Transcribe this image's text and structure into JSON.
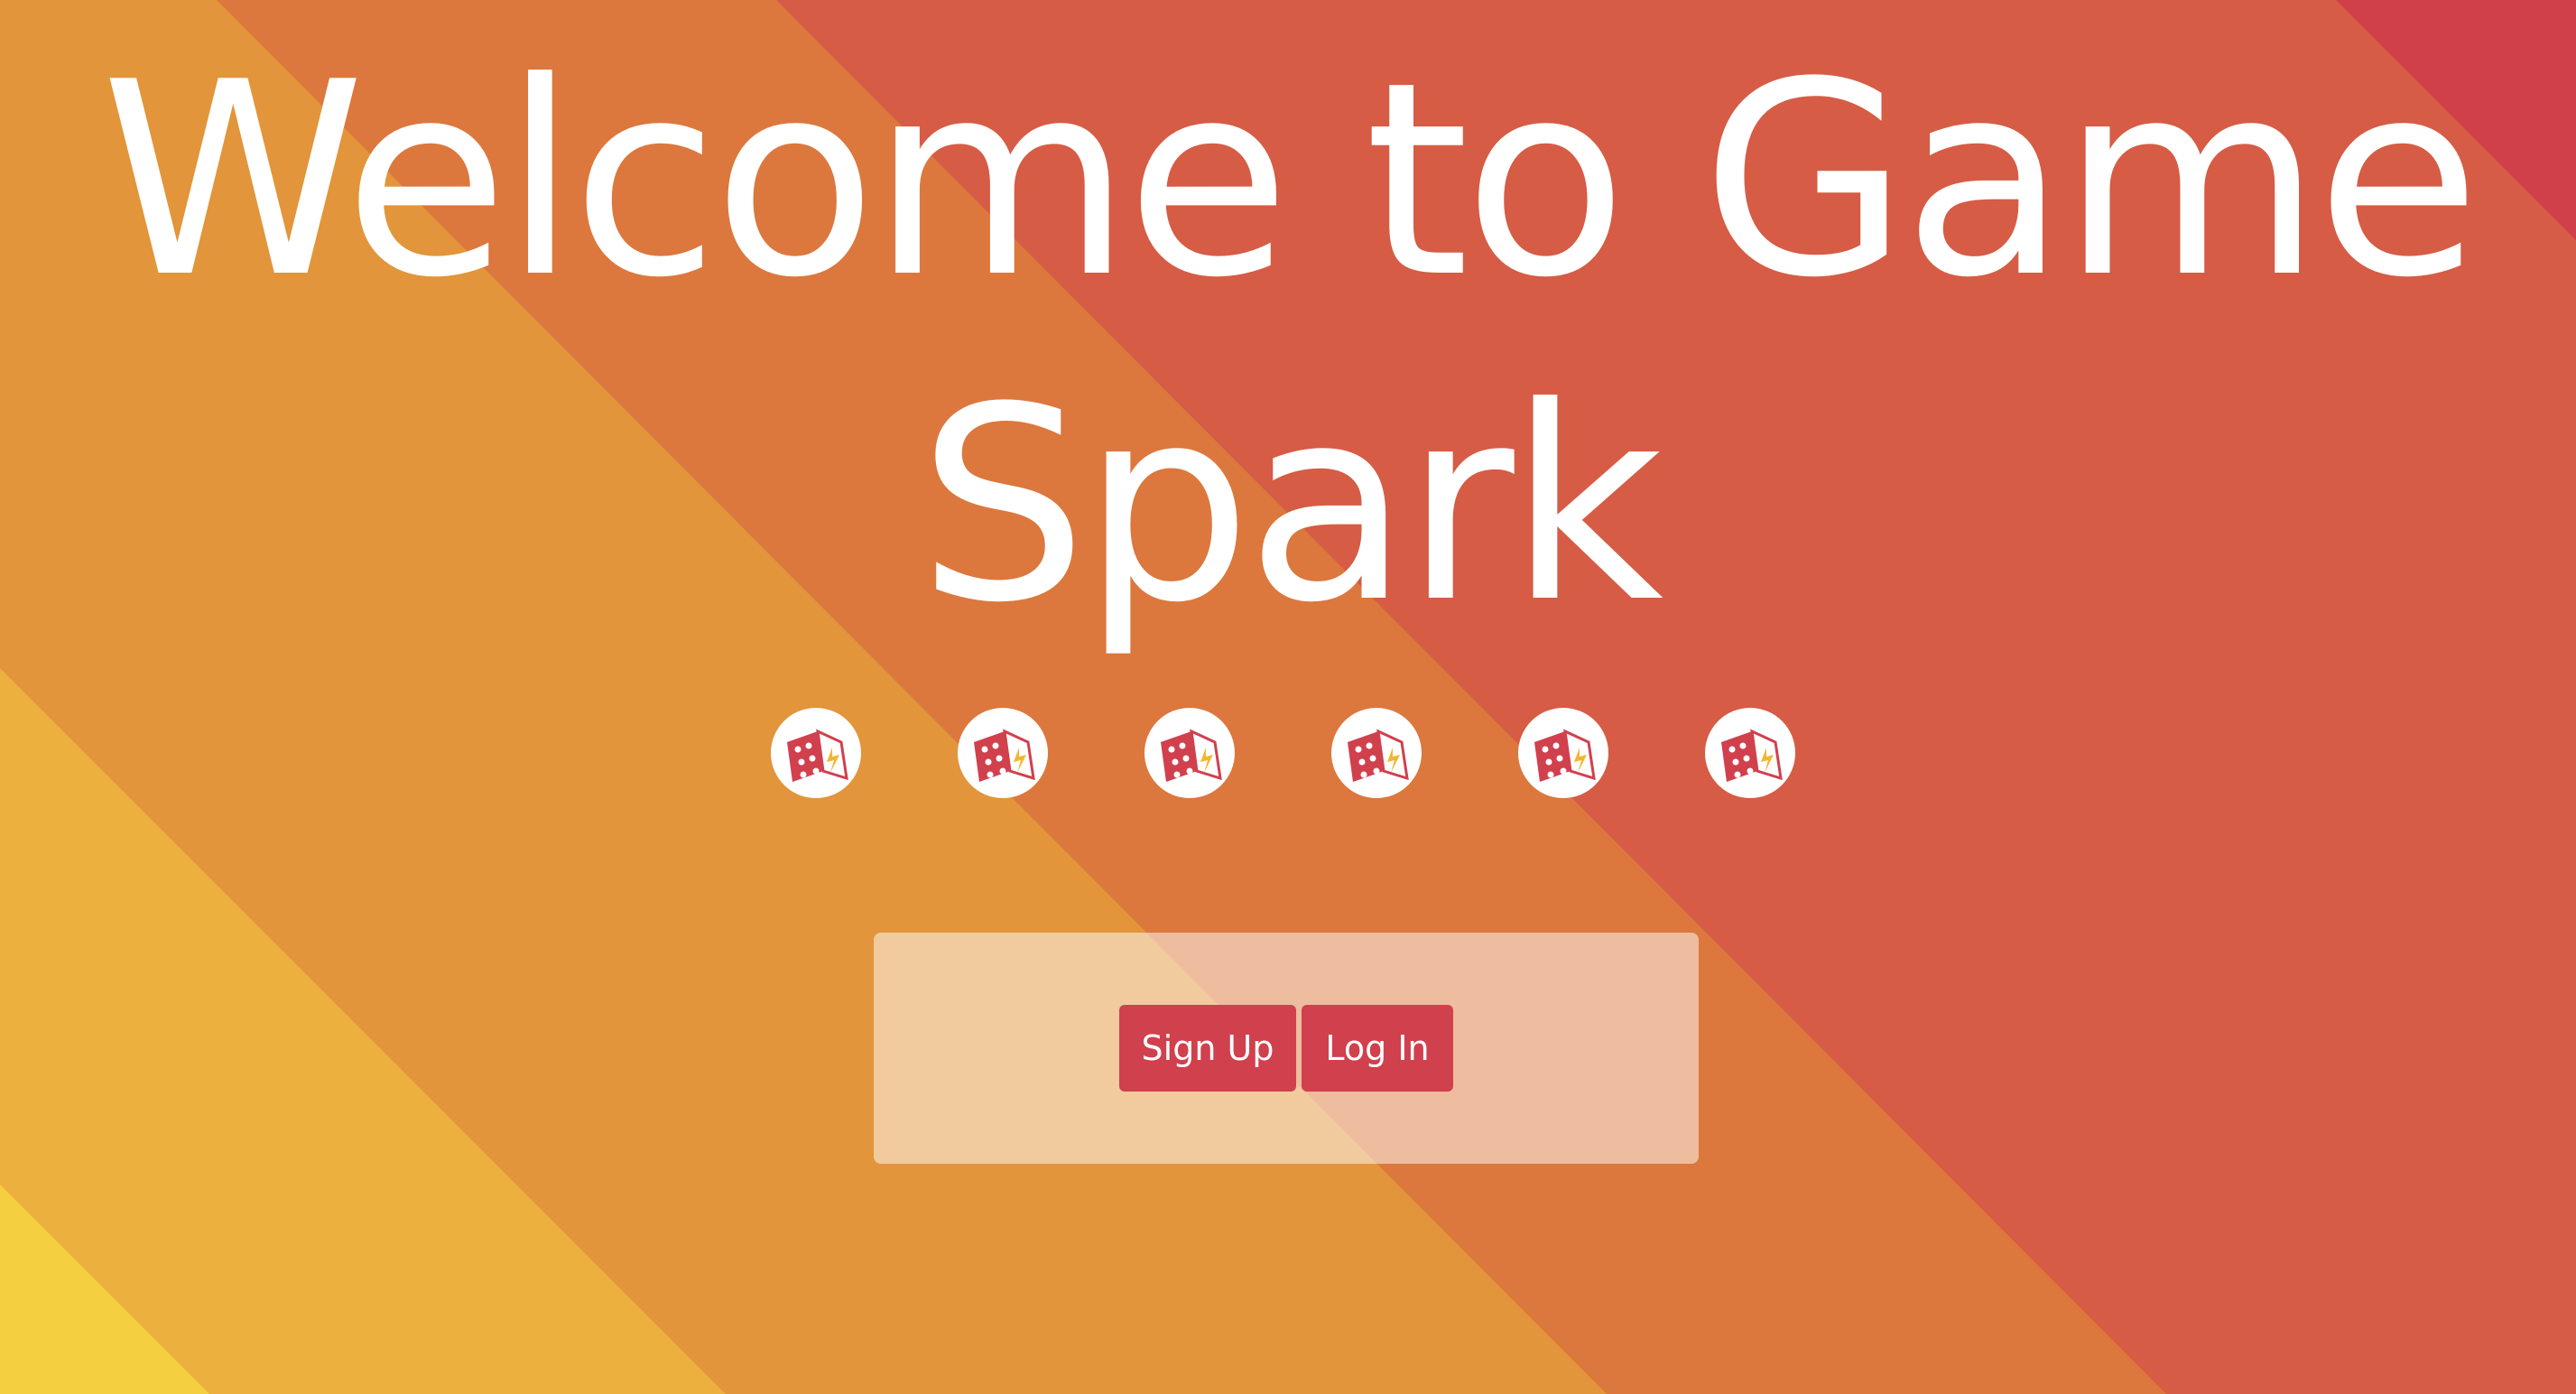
{
  "page": {
    "title_line1": "Welcome to Game",
    "title_line2": "Spark"
  },
  "dice": [
    {
      "icon": "dice-spark-icon"
    },
    {
      "icon": "dice-spark-icon"
    },
    {
      "icon": "dice-spark-icon"
    },
    {
      "icon": "dice-spark-icon"
    },
    {
      "icon": "dice-spark-icon"
    },
    {
      "icon": "dice-spark-icon"
    }
  ],
  "auth": {
    "signup_label": "Sign Up",
    "login_label": "Log In"
  },
  "colors": {
    "button_bg": "#d1404d",
    "stripe_yellow": "#f4cf3f",
    "stripe_light_orange": "#ecb03f",
    "stripe_orange": "#e2953a",
    "stripe_dark_orange": "#dc783d",
    "stripe_red_orange": "#d65c45",
    "stripe_red": "#cf404b"
  }
}
